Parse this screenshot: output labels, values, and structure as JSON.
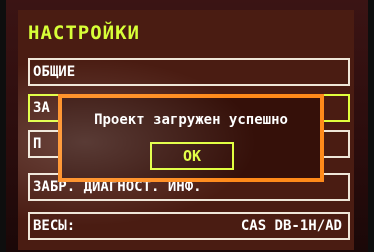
{
  "screen": {
    "title": "НАСТРОЙКИ",
    "menu": [
      {
        "label": "ОБЩИЕ",
        "value": ""
      },
      {
        "label": "ЗА",
        "value": ""
      },
      {
        "label": "П",
        "value": ""
      },
      {
        "label": "ЗАБР. ДИАГНОСТ. ИНФ.",
        "value": ""
      },
      {
        "label": "ВЕСЫ:",
        "value": "CAS DB-1H/AD"
      }
    ]
  },
  "dialog": {
    "message": "Проект загружен успешно",
    "ok_label": "OK"
  },
  "colors": {
    "background": "#4a1c12",
    "title": "#d7ff38",
    "dialog_border": "#ff8a1a",
    "ok_border": "#e0ff3c"
  }
}
